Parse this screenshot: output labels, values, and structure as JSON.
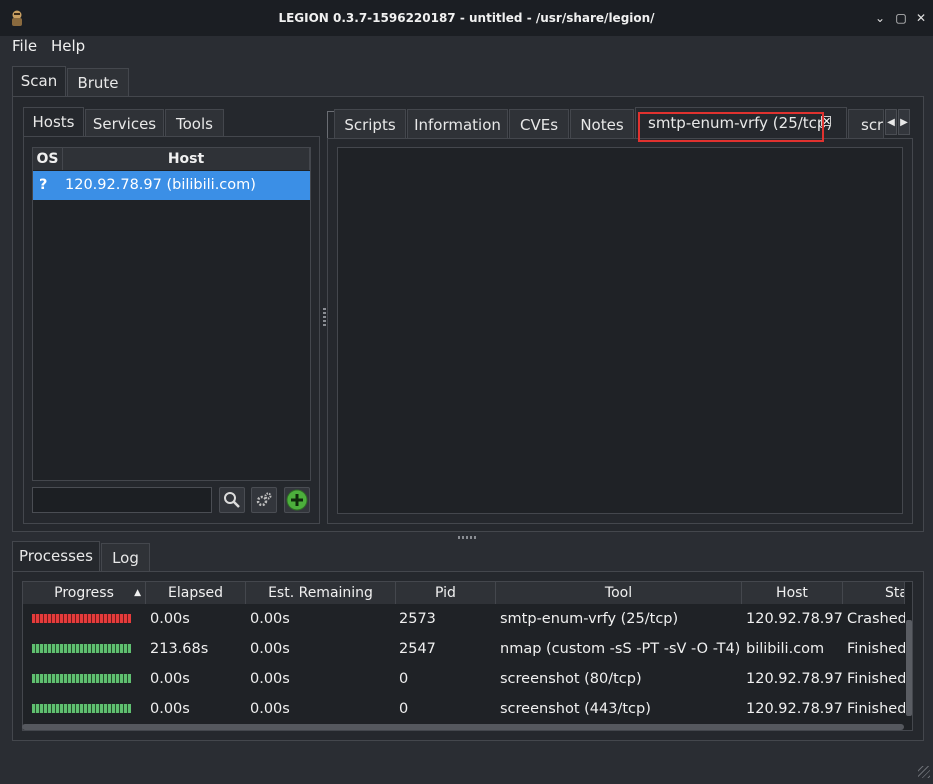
{
  "window": {
    "title": "LEGION 0.3.7-1596220187 - untitled - /usr/share/legion/",
    "controls": [
      "⌄",
      "▢",
      "✕"
    ]
  },
  "menu": [
    "File",
    "Help"
  ],
  "main_tabs": [
    "Scan",
    "Brute"
  ],
  "left_tabs": [
    "Hosts",
    "Services",
    "Tools"
  ],
  "hosts_table": {
    "headers": [
      "OS",
      "Host"
    ],
    "rows": [
      {
        "os": "?",
        "host": "120.92.78.97 (bilibili.com)"
      }
    ]
  },
  "right_tabs": [
    "Scripts",
    "Information",
    "CVEs",
    "Notes",
    "smtp-enum-vrfy (25/tcp)",
    "scre"
  ],
  "bottom_tabs": [
    "Processes",
    "Log"
  ],
  "processes": {
    "headers": [
      "Progress",
      "Elapsed",
      "Est. Remaining",
      "Pid",
      "Tool",
      "Host",
      "Sta"
    ],
    "rows": [
      {
        "progress_status": "error",
        "elapsed": "0.00s",
        "remaining": "0.00s",
        "pid": "2573",
        "tool": "smtp-enum-vrfy (25/tcp)",
        "host": "120.92.78.97",
        "status": "Crashed"
      },
      {
        "progress_status": "ok",
        "elapsed": "213.68s",
        "remaining": "0.00s",
        "pid": "2547",
        "tool": "nmap (custom -sS -PT -sV -O -T4)",
        "host": "bilibili.com",
        "status": "Finished"
      },
      {
        "progress_status": "ok",
        "elapsed": "0.00s",
        "remaining": "0.00s",
        "pid": "0",
        "tool": "screenshot (80/tcp)",
        "host": "120.92.78.97",
        "status": "Finished"
      },
      {
        "progress_status": "ok",
        "elapsed": "0.00s",
        "remaining": "0.00s",
        "pid": "0",
        "tool": "screenshot (443/tcp)",
        "host": "120.92.78.97",
        "status": "Finished"
      }
    ]
  },
  "colors": {
    "selection": "#3b8fe6",
    "highlight_box": "#e0322f",
    "progress_ok": "#5fbf70",
    "progress_error": "#e53b3b"
  },
  "icons": {
    "search": "search-icon",
    "settings": "gears-icon",
    "add": "add-icon"
  }
}
